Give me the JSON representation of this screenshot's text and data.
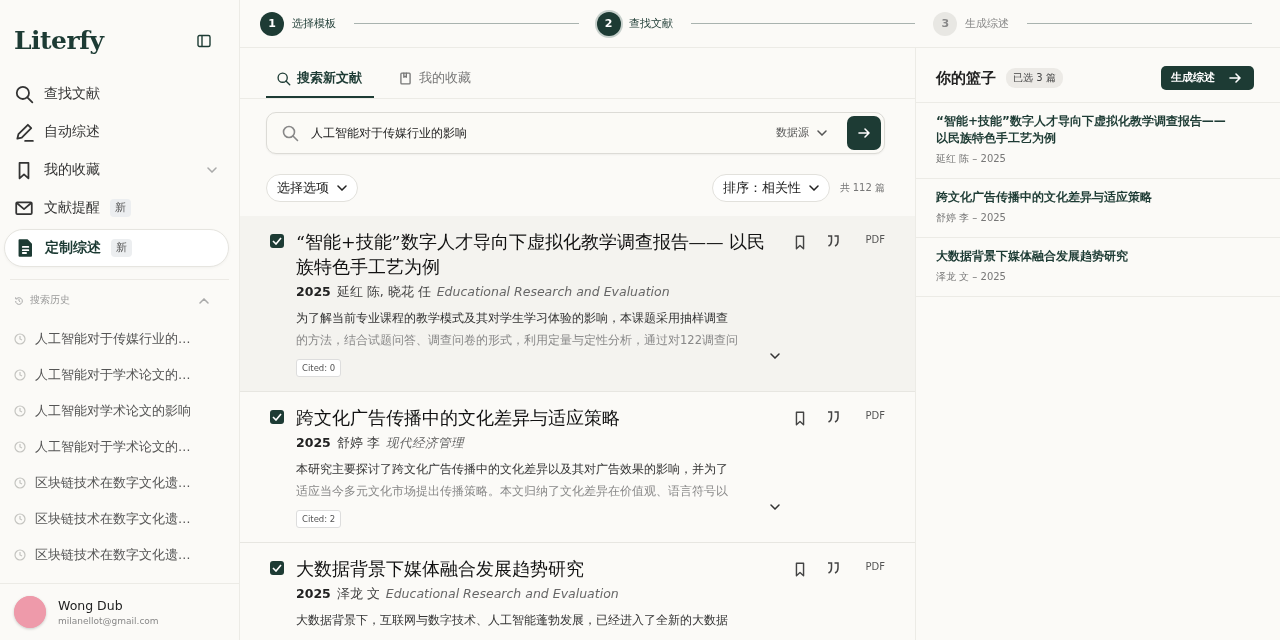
{
  "sidebar": {
    "logo": "Literfy",
    "nav": [
      {
        "label": "查找文献",
        "expandable": false,
        "selected": false
      },
      {
        "label": "自动综述",
        "expandable": false,
        "selected": false
      },
      {
        "label": "我的收藏",
        "expandable": true,
        "selected": false
      },
      {
        "label": "文献提醒",
        "badge": "新",
        "expandable": false,
        "selected": false
      },
      {
        "label": "定制综述",
        "badge": "新",
        "expandable": false,
        "selected": true
      }
    ],
    "history": {
      "title": "搜索历史",
      "expanded": true,
      "items": [
        "人工智能对于传媒行业的…",
        "人工智能对于学术论文的…",
        "人工智能对学术论文的影响",
        "人工智能对于学术论文的…",
        "区块链技术在数字文化遗…",
        "区块链技术在数字文化遗…",
        "区块链技术在数字文化遗…"
      ]
    },
    "user": {
      "name": "Wong Dub",
      "email": "milanellot@gmail.com"
    }
  },
  "steps": [
    {
      "number": "1",
      "label": "选择模板",
      "completed": true,
      "selected": false
    },
    {
      "number": "2",
      "label": "查找文献",
      "completed": false,
      "selected": true
    },
    {
      "number": "3",
      "label": "生成综述",
      "completed": false,
      "selected": false
    }
  ],
  "tabs": [
    {
      "label": "搜索新文献",
      "selected": true
    },
    {
      "label": "我的收藏",
      "selected": false
    }
  ],
  "search": {
    "value": "人工智能对于传媒行业的影响",
    "source": "数据源"
  },
  "filter": "选择选项",
  "sort": "排序：相关性",
  "total": "共 112 篇",
  "papers": [
    {
      "checked": true,
      "title": "“智能+技能”数字人才导向下虚拟化教学调查报告—— 以民族特色手工艺为例",
      "year": "2025",
      "authors": "延红 陈, 晓花 任",
      "venue": "Educational Research and Evaluation",
      "abstract": [
        "为了解当前专业课程的教学模式及其对学生学习体验的影响，本课题采用抽样调查",
        "的方法，结合试题问答、调查问卷的形式，利用定量与定性分析，通过对122调查问"
      ],
      "cited": "Cited: 0",
      "pdf": "PDF"
    },
    {
      "checked": true,
      "title": "跨文化广告传播中的文化差异与适应策略",
      "year": "2025",
      "authors": "舒婷 李",
      "venue": "现代经济管理",
      "abstract": [
        "本研究主要探讨了跨文化广告传播中的文化差异以及其对广告效果的影响，并为了",
        "适应当今多元文化市场提出传播策略。本文归纳了文化差异在价值观、语言符号以"
      ],
      "cited": "Cited: 2",
      "pdf": "PDF"
    },
    {
      "checked": true,
      "title": "大数据背景下媒体融合发展趋势研究",
      "year": "2025",
      "authors": "泽龙 文",
      "venue": "Educational Research and Evaluation",
      "abstract": [
        "大数据背景下，互联网与数字技术、人工智能蓬勃发展，已经进入了全新的大数据"
      ],
      "pdf": "PDF"
    }
  ],
  "basket": {
    "title": "你的篮子",
    "count": "已选 3 篇",
    "action": "生成综述",
    "items": [
      {
        "title": "“智能+技能”数字人才导向下虚拟化教学调查报告——以民族特色手工艺为例",
        "meta": "延红 陈 – 2025"
      },
      {
        "title": "跨文化广告传播中的文化差异与适应策略",
        "meta": "舒婷 李 – 2025"
      },
      {
        "title": "大数据背景下媒体融合发展趋势研究",
        "meta": "泽龙 文 – 2025"
      }
    ]
  }
}
